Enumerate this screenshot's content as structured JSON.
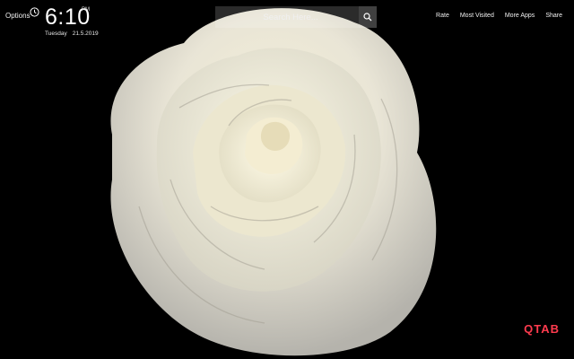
{
  "options_label": "Options",
  "clock": {
    "time": "6:10",
    "period": "PM",
    "day": "Tuesday",
    "date": "21.5.2019"
  },
  "search": {
    "placeholder": "Search Here..."
  },
  "nav": {
    "rate": "Rate",
    "most_visited": "Most Visited",
    "more_apps": "More Apps",
    "share": "Share"
  },
  "brand": {
    "text": "QTAB",
    "color": "#ff3b4e"
  },
  "icons": {
    "clock": "clock-icon",
    "search": "search-icon"
  },
  "wallpaper": {
    "subject": "white rose on black background"
  }
}
